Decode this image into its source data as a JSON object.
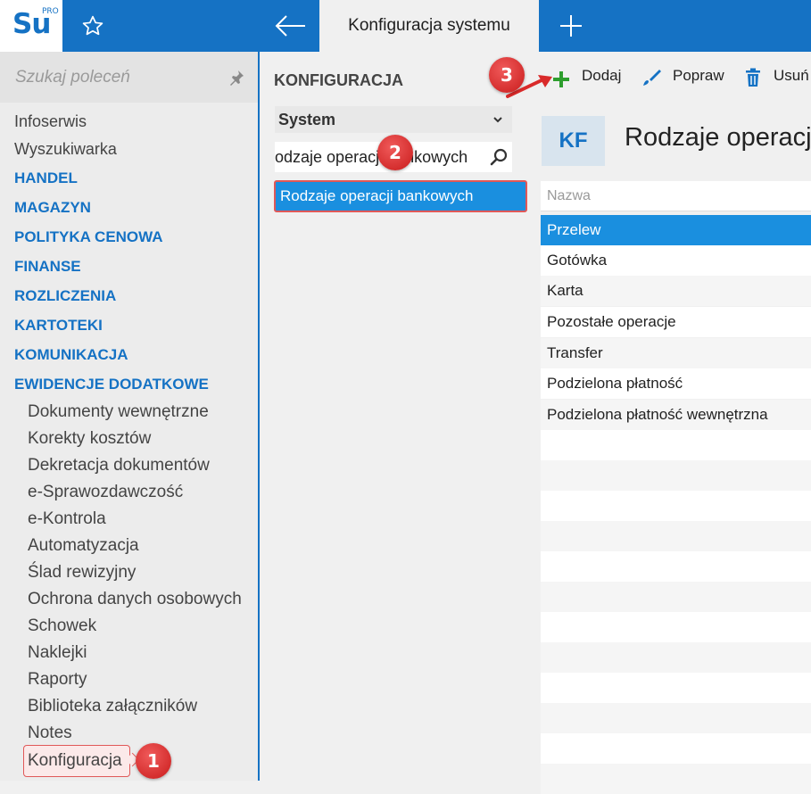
{
  "app": {
    "logo_text": "Su",
    "logo_sup": "PRO",
    "tab_title": "Konfiguracja systemu"
  },
  "sidebar": {
    "search_placeholder": "Szukaj poleceń",
    "top_items": [
      "Infoserwis",
      "Wyszukiwarka"
    ],
    "categories": [
      "HANDEL",
      "MAGAZYN",
      "POLITYKA CENOWA",
      "FINANSE",
      "ROZLICZENIA",
      "KARTOTEKI",
      "KOMUNIKACJA",
      "EWIDENCJE DODATKOWE"
    ],
    "sub_items": [
      "Dokumenty wewnętrzne",
      "Korekty kosztów",
      "Dekretacja dokumentów",
      "e-Sprawozdawczość",
      "e-Kontrola",
      "Automatyzacja",
      "Ślad rewizyjny",
      "Ochrona danych osobowych",
      "Schowek",
      "Naklejki",
      "Raporty",
      "Biblioteka załączników",
      "Notes",
      "Konfiguracja"
    ]
  },
  "config": {
    "title": "KONFIGURACJA",
    "select_value": "System",
    "filter_value": "odzaje operacji bankowych",
    "result": "Rodzaje operacji bankowych"
  },
  "toolbar": {
    "add": "Dodaj",
    "edit": "Popraw",
    "delete": "Usuń"
  },
  "main": {
    "badge": "KF",
    "title": "Rodzaje operacj",
    "column": "Nazwa",
    "rows": [
      "Przelew",
      "Gotówka",
      "Karta",
      "Pozostałe operacje",
      "Transfer",
      "Podzielona płatność",
      "Podzielona płatność wewnętrzna"
    ]
  },
  "annotations": [
    "1",
    "2",
    "3"
  ],
  "colors": {
    "brand": "#1572c4",
    "selection": "#1a8fdf",
    "callout": "#d92a2a",
    "add_icon": "#2e9e2e"
  }
}
